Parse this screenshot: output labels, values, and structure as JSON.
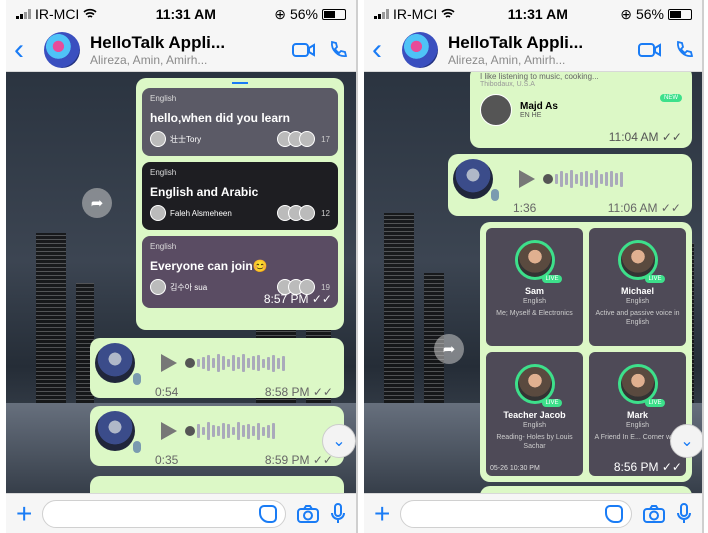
{
  "status": {
    "carrier": "IR-MCI",
    "time": "11:31 AM",
    "battery": "56%"
  },
  "header": {
    "title": "HelloTalk Appli...",
    "subtitle": "Alireza, Amin, Amirh..."
  },
  "left": {
    "cards": [
      {
        "lang": "English",
        "title": "hello,when did you learn",
        "host": "壮士Tory",
        "count": "17",
        "bg": "#5b5a66"
      },
      {
        "lang": "English",
        "title": "English and Arabic",
        "host": "Faleh Alsmeheen",
        "count": "12",
        "bg": "#1e1e22"
      },
      {
        "lang": "English",
        "title": "Everyone can join😊",
        "host": "김수아  sua",
        "count": "19",
        "bg": "#5a4c63"
      }
    ],
    "card_time": "8:57 PM",
    "voice": [
      {
        "duration": "0:54",
        "time": "8:58 PM"
      },
      {
        "duration": "0:35",
        "time": "8:59 PM"
      }
    ]
  },
  "right": {
    "peek": {
      "text": "I like listening to music, cooking...",
      "loc": "Thibodaux, U.S.A",
      "name": "Majd As",
      "langs": "EN   HE",
      "badge": "NEW",
      "time": "11:04 AM"
    },
    "voice": {
      "duration": "1:36",
      "time": "11:06 AM"
    },
    "teachers": [
      {
        "name": "Sam",
        "lang": "English",
        "desc": "Me; Myself & Electronics"
      },
      {
        "name": "Michael",
        "lang": "English",
        "desc": "Active and passive voice in English"
      },
      {
        "name": "Teacher Jacob",
        "lang": "English",
        "desc": "Reading- Holes by Louis Sachar"
      },
      {
        "name": "Mark",
        "lang": "English",
        "desc": "A Friend In E... Corner wit..."
      }
    ],
    "teacher_date": "05-26 10:30 PM",
    "teacher_time": "8:56 PM",
    "live_label": "LIVE"
  },
  "colors": {
    "accent": "#1a7cf5",
    "bubble": "#dcf8c6"
  }
}
